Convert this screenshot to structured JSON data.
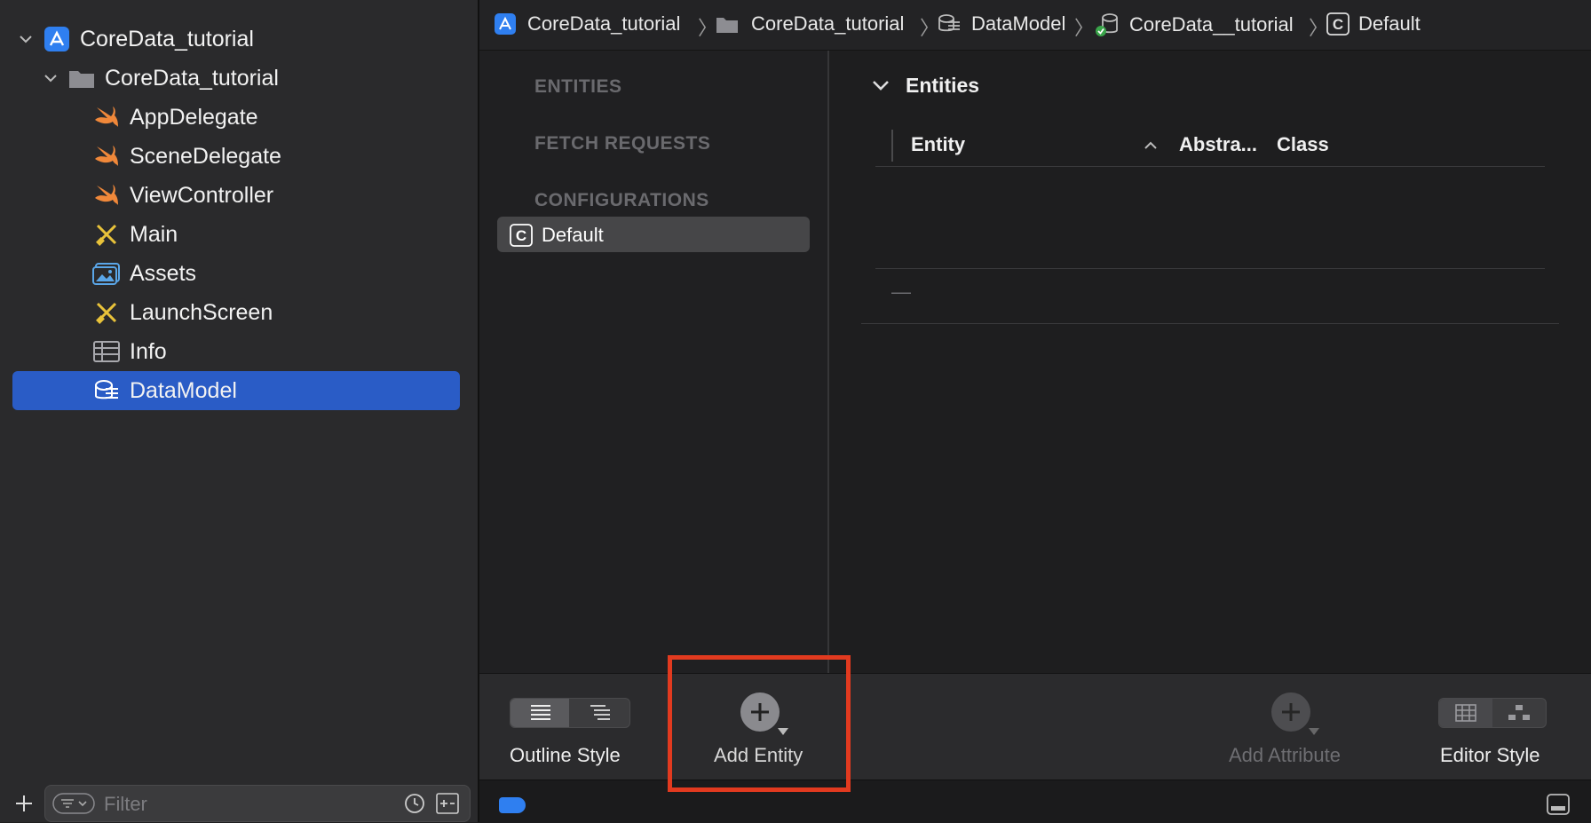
{
  "navigator": {
    "project_name": "CoreData_tutorial",
    "group_name": "CoreData_tutorial",
    "files": [
      {
        "label": "AppDelegate",
        "icon": "swift-icon"
      },
      {
        "label": "SceneDelegate",
        "icon": "swift-icon"
      },
      {
        "label": "ViewController",
        "icon": "swift-icon"
      },
      {
        "label": "Main",
        "icon": "storyboard-icon"
      },
      {
        "label": "Assets",
        "icon": "assets-icon"
      },
      {
        "label": "LaunchScreen",
        "icon": "storyboard-icon"
      },
      {
        "label": "Info",
        "icon": "plist-icon"
      },
      {
        "label": "DataModel",
        "icon": "datamodel-icon"
      }
    ],
    "selected_file": "DataModel",
    "filter_placeholder": "Filter"
  },
  "breadcrumb": {
    "items": [
      "CoreData_tutorial",
      "CoreData_tutorial",
      "DataModel",
      "CoreData__tutorial",
      "Default"
    ]
  },
  "outline": {
    "entities_header": "ENTITIES",
    "fetch_requests_header": "FETCH REQUESTS",
    "configurations_header": "CONFIGURATIONS",
    "selected_configuration": "Default"
  },
  "editor": {
    "section_title": "Entities",
    "columns": [
      "Entity",
      "Abstra...",
      "Class"
    ],
    "empty_marker": "—"
  },
  "toolbar": {
    "outline_style_label": "Outline Style",
    "add_entity_label": "Add Entity",
    "add_attribute_label": "Add Attribute",
    "editor_style_label": "Editor Style"
  },
  "colors": {
    "selection": "#2a5cc6",
    "highlight_box": "#e23a1f",
    "swift_orange": "#f0883a",
    "folder_blue": "#4a90e2"
  }
}
